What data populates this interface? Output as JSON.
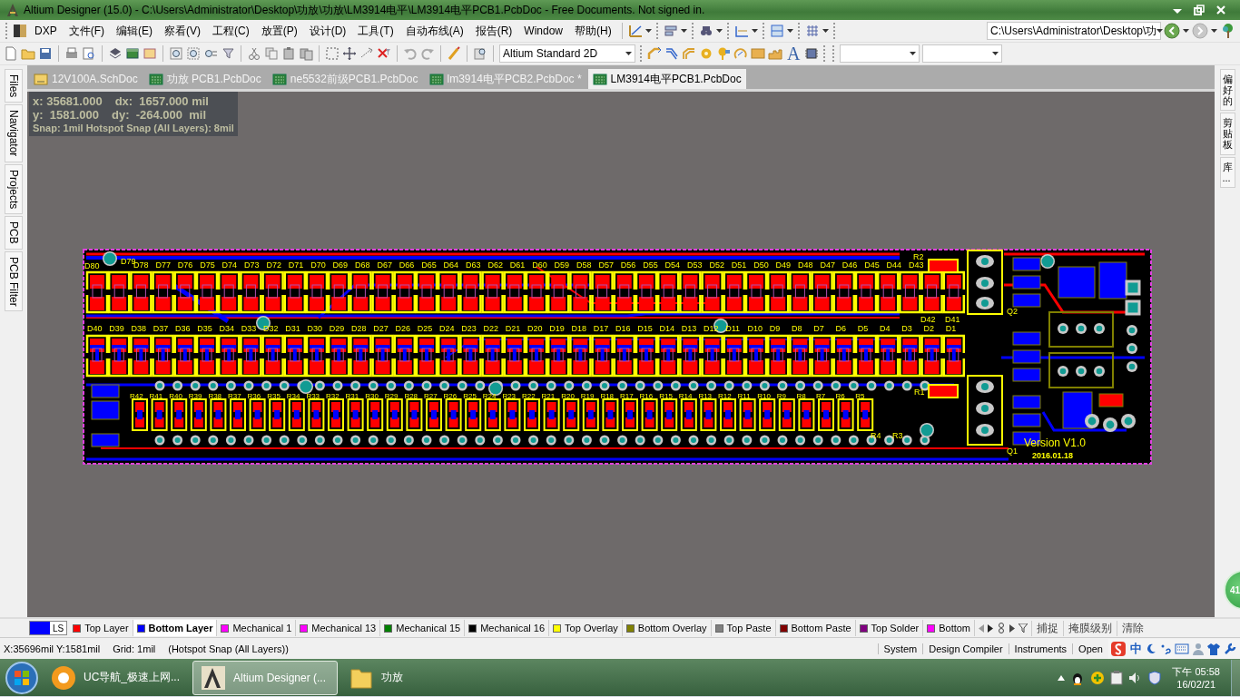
{
  "window": {
    "title": "Altium Designer (15.0) - C:\\Users\\Administrator\\Desktop\\功放\\功放\\LM3914电平\\LM3914电平PCB1.PcbDoc - Free Documents. Not signed in."
  },
  "menu": {
    "app": "DXP",
    "items": [
      "文件(F)",
      "编辑(E)",
      "察看(V)",
      "工程(C)",
      "放置(P)",
      "设计(D)",
      "工具(T)",
      "自动布线(A)",
      "报告(R)",
      "Window",
      "帮助(H)"
    ]
  },
  "path_field": {
    "value": "C:\\Users\\Administrator\\Desktop\\功"
  },
  "view_select": {
    "value": "Altium Standard 2D"
  },
  "string_tool": "A",
  "left_panels": [
    "Files",
    "Navigator",
    "Projects",
    "PCB",
    "PCB Filter"
  ],
  "right_panels": [
    "偏好的",
    "剪贴板",
    "库..."
  ],
  "documents": [
    {
      "label": "12V100A.SchDoc",
      "kind": "sch",
      "selected": false
    },
    {
      "label": "功放 PCB1.PcbDoc",
      "kind": "pcb",
      "selected": false
    },
    {
      "label": "ne5532前级PCB1.PcbDoc",
      "kind": "pcb",
      "selected": false
    },
    {
      "label": "lm3914电平PCB2.PcbDoc *",
      "kind": "pcb",
      "selected": false
    },
    {
      "label": "LM3914电平PCB1.PcbDoc",
      "kind": "pcb",
      "selected": true
    }
  ],
  "readout": {
    "rows": [
      [
        "x: 35681.000",
        "dx:  1657.000 mil"
      ],
      [
        "y:  1581.000",
        "dy:  -264.000  mil"
      ]
    ],
    "snap": "Snap: 1mil Hotspot Snap (All Layers): 8mil"
  },
  "pcb": {
    "top_labels": [
      "D78",
      "D77",
      "D76",
      "D75",
      "D74",
      "D73",
      "D72",
      "D71",
      "D70",
      "D69",
      "D68",
      "D67",
      "D66",
      "D65",
      "D64",
      "D63",
      "D62",
      "D61",
      "D60",
      "D59",
      "D58",
      "D57",
      "D56",
      "D55",
      "D54",
      "D53",
      "D52",
      "D51",
      "D50",
      "D49",
      "D48",
      "D47",
      "D46",
      "D45",
      "D44",
      "D43"
    ],
    "middle_labels": [
      "D40",
      "D39",
      "D38",
      "D37",
      "D36",
      "D35",
      "D34",
      "D33",
      "D32",
      "D31",
      "D30",
      "D29",
      "D28",
      "D27",
      "D26",
      "D25",
      "D24",
      "D23",
      "D22",
      "D21",
      "D20",
      "D19",
      "D18",
      "D17",
      "D16",
      "D15",
      "D14",
      "D13",
      "D12",
      "D11",
      "D10",
      "D9",
      "D8",
      "D7",
      "D6",
      "D5",
      "D4",
      "D3",
      "D2",
      "D1"
    ],
    "resistor_labels": [
      "R42",
      "R41",
      "R40",
      "R39",
      "R38",
      "R37",
      "R36",
      "R35",
      "R34",
      "R33",
      "R32",
      "R31",
      "R30",
      "R29",
      "R28",
      "R27",
      "R26",
      "R25",
      "R24",
      "R23",
      "R22",
      "R21",
      "R20",
      "R19",
      "R18",
      "R17",
      "R16",
      "R15",
      "R14",
      "R13",
      "R12",
      "R11",
      "R10",
      "R9",
      "R8",
      "R7",
      "R6",
      "R5"
    ],
    "other_labels": [
      {
        "text": "D80",
        "kind": "designator"
      },
      {
        "text": "D79",
        "kind": "designator"
      },
      {
        "text": "D42",
        "kind": "designator"
      },
      {
        "text": "D41",
        "kind": "designator"
      },
      {
        "text": "R2",
        "kind": "designator"
      },
      {
        "text": "R1",
        "kind": "designator"
      },
      {
        "text": "R4",
        "kind": "designator"
      },
      {
        "text": "R3",
        "kind": "designator"
      },
      {
        "text": "Q2",
        "kind": "designator"
      },
      {
        "text": "Q1",
        "kind": "designator"
      },
      {
        "text": "Version V1.0",
        "kind": "version"
      },
      {
        "text": "2016.01.18",
        "kind": "date"
      }
    ]
  },
  "meter": {
    "text": "41"
  },
  "current_layer": {
    "label": "LS",
    "color": "#0000ff"
  },
  "layers": [
    {
      "label": "Top Layer",
      "color": "#ff0000",
      "selected": false
    },
    {
      "label": "Bottom Layer",
      "color": "#0000ff",
      "selected": true
    },
    {
      "label": "Mechanical 1",
      "color": "#ff00ff",
      "selected": false
    },
    {
      "label": "Mechanical 13",
      "color": "#ff00ff",
      "selected": false
    },
    {
      "label": "Mechanical 15",
      "color": "#008000",
      "selected": false
    },
    {
      "label": "Mechanical 16",
      "color": "#000000",
      "selected": false
    },
    {
      "label": "Top Overlay",
      "color": "#ffff00",
      "selected": false
    },
    {
      "label": "Bottom Overlay",
      "color": "#808000",
      "selected": false
    },
    {
      "label": "Top Paste",
      "color": "#808080",
      "selected": false
    },
    {
      "label": "Bottom Paste",
      "color": "#800000",
      "selected": false
    },
    {
      "label": "Top Solder",
      "color": "#800080",
      "selected": false
    },
    {
      "label": "Bottom",
      "color": "#ff00ff",
      "selected": false
    }
  ],
  "layer_buttons": [
    "捕捉",
    "掩膜级别",
    "清除"
  ],
  "status": {
    "texts": [
      "X:35696mil Y:1581mil",
      "Grid: 1mil",
      "(Hotspot Snap (All Layers))"
    ],
    "panels": [
      "System",
      "Design Compiler",
      "Instruments",
      "Open"
    ]
  },
  "ime": {
    "label": "中"
  },
  "taskbar": {
    "buttons": [
      {
        "label": "UC导航_极速上网...",
        "kind": "browser",
        "selected": false
      },
      {
        "label": "Altium Designer (...",
        "kind": "altium",
        "selected": true
      },
      {
        "label": "功放",
        "kind": "folder",
        "selected": false
      }
    ],
    "time": "下午 05:58",
    "date": "16/02/21"
  }
}
